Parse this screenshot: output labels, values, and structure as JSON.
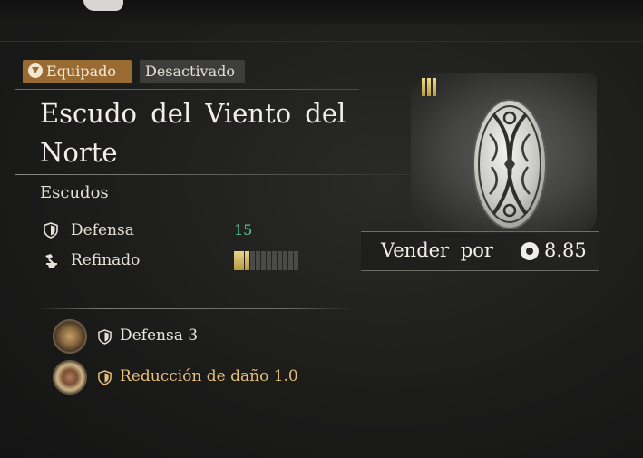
{
  "status_tags": {
    "equipped": "Equipado",
    "disabled": "Desactivado"
  },
  "item": {
    "name": "Escudo del Viento del Norte",
    "category": "Escudos",
    "tier_level": 3
  },
  "stats": {
    "defense": {
      "label": "Defensa",
      "value": "15",
      "icon": "shield-icon"
    },
    "refine": {
      "label": "Refinado",
      "icon": "hammer-icon",
      "level": 3,
      "max_level": 12
    }
  },
  "sell": {
    "label": "Vender por",
    "value": "8.85",
    "icon": "coin-icon"
  },
  "effects": [
    {
      "text": "Defensa 3",
      "icon": "shield-icon",
      "gem": "bronze-gem-icon"
    },
    {
      "text": "Reducción de daño 1.0",
      "icon": "shield-icon",
      "gem": "gold-gem-icon"
    }
  ],
  "colors": {
    "equipped_tag": "#9a6a33",
    "stat_value": "#57c08f",
    "bonus_effect_text": "#e8c07a",
    "refine_active": "#d9c06a"
  }
}
